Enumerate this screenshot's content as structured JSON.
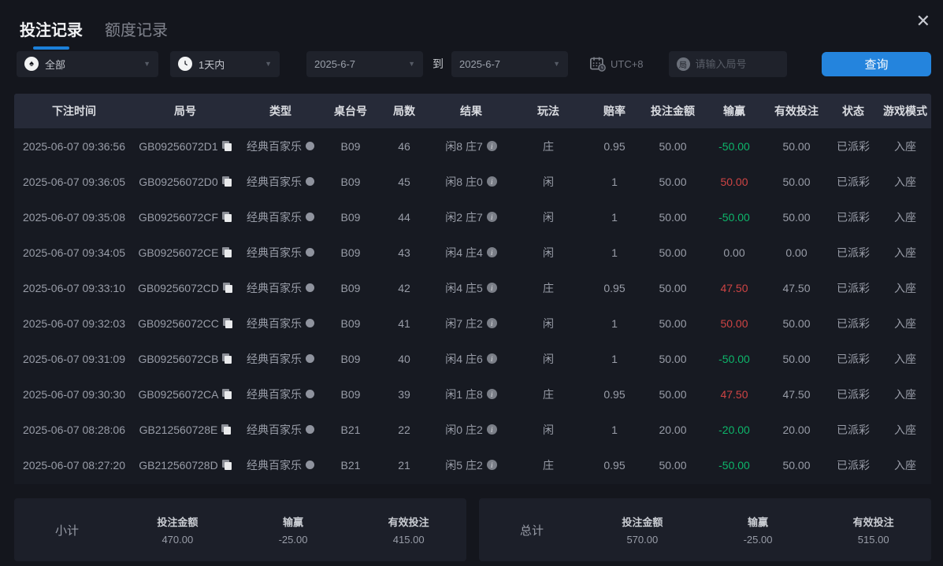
{
  "tabs": [
    {
      "label": "投注记录",
      "active": true
    },
    {
      "label": "额度记录",
      "active": false
    }
  ],
  "icons": {
    "spade": "♠",
    "chevron": "▼",
    "close": "✕",
    "round_badge": "局",
    "info": "i"
  },
  "filters": {
    "game_type_value": "全部",
    "time_range_value": "1天内",
    "date_from": "2025-6-7",
    "to_label": "到",
    "date_to": "2025-6-7",
    "timezone": "UTC+8",
    "round_placeholder": "请输入局号",
    "query_label": "查询"
  },
  "table": {
    "columns": [
      "下注时间",
      "局号",
      "类型",
      "桌台号",
      "局数",
      "结果",
      "玩法",
      "赔率",
      "投注金额",
      "输赢",
      "有效投注",
      "状态",
      "游戏模式"
    ],
    "rows": [
      {
        "time": "2025-06-07 09:36:56",
        "game_no": "GB09256072D1",
        "type": "经典百家乐",
        "table_no": "B09",
        "round": "46",
        "result": "闲8 庄7",
        "play": "庄",
        "odds": "0.95",
        "amount": "50.00",
        "win_loss": "-50.00",
        "win_loss_class": "neg",
        "valid": "50.00",
        "status": "已派彩",
        "mode": "入座"
      },
      {
        "time": "2025-06-07 09:36:05",
        "game_no": "GB09256072D0",
        "type": "经典百家乐",
        "table_no": "B09",
        "round": "45",
        "result": "闲8 庄0",
        "play": "闲",
        "odds": "1",
        "amount": "50.00",
        "win_loss": "50.00",
        "win_loss_class": "pos",
        "valid": "50.00",
        "status": "已派彩",
        "mode": "入座"
      },
      {
        "time": "2025-06-07 09:35:08",
        "game_no": "GB09256072CF",
        "type": "经典百家乐",
        "table_no": "B09",
        "round": "44",
        "result": "闲2 庄7",
        "play": "闲",
        "odds": "1",
        "amount": "50.00",
        "win_loss": "-50.00",
        "win_loss_class": "neg",
        "valid": "50.00",
        "status": "已派彩",
        "mode": "入座"
      },
      {
        "time": "2025-06-07 09:34:05",
        "game_no": "GB09256072CE",
        "type": "经典百家乐",
        "table_no": "B09",
        "round": "43",
        "result": "闲4 庄4",
        "play": "闲",
        "odds": "1",
        "amount": "50.00",
        "win_loss": "0.00",
        "win_loss_class": "zero",
        "valid": "0.00",
        "status": "已派彩",
        "mode": "入座"
      },
      {
        "time": "2025-06-07 09:33:10",
        "game_no": "GB09256072CD",
        "type": "经典百家乐",
        "table_no": "B09",
        "round": "42",
        "result": "闲4 庄5",
        "play": "庄",
        "odds": "0.95",
        "amount": "50.00",
        "win_loss": "47.50",
        "win_loss_class": "pos",
        "valid": "47.50",
        "status": "已派彩",
        "mode": "入座"
      },
      {
        "time": "2025-06-07 09:32:03",
        "game_no": "GB09256072CC",
        "type": "经典百家乐",
        "table_no": "B09",
        "round": "41",
        "result": "闲7 庄2",
        "play": "闲",
        "odds": "1",
        "amount": "50.00",
        "win_loss": "50.00",
        "win_loss_class": "pos",
        "valid": "50.00",
        "status": "已派彩",
        "mode": "入座"
      },
      {
        "time": "2025-06-07 09:31:09",
        "game_no": "GB09256072CB",
        "type": "经典百家乐",
        "table_no": "B09",
        "round": "40",
        "result": "闲4 庄6",
        "play": "闲",
        "odds": "1",
        "amount": "50.00",
        "win_loss": "-50.00",
        "win_loss_class": "neg",
        "valid": "50.00",
        "status": "已派彩",
        "mode": "入座"
      },
      {
        "time": "2025-06-07 09:30:30",
        "game_no": "GB09256072CA",
        "type": "经典百家乐",
        "table_no": "B09",
        "round": "39",
        "result": "闲1 庄8",
        "play": "庄",
        "odds": "0.95",
        "amount": "50.00",
        "win_loss": "47.50",
        "win_loss_class": "pos",
        "valid": "47.50",
        "status": "已派彩",
        "mode": "入座"
      },
      {
        "time": "2025-06-07 08:28:06",
        "game_no": "GB212560728E",
        "type": "经典百家乐",
        "table_no": "B21",
        "round": "22",
        "result": "闲0 庄2",
        "play": "闲",
        "odds": "1",
        "amount": "20.00",
        "win_loss": "-20.00",
        "win_loss_class": "neg",
        "valid": "20.00",
        "status": "已派彩",
        "mode": "入座"
      },
      {
        "time": "2025-06-07 08:27:20",
        "game_no": "GB212560728D",
        "type": "经典百家乐",
        "table_no": "B21",
        "round": "21",
        "result": "闲5 庄2",
        "play": "庄",
        "odds": "0.95",
        "amount": "50.00",
        "win_loss": "-50.00",
        "win_loss_class": "neg",
        "valid": "50.00",
        "status": "已派彩",
        "mode": "入座"
      }
    ]
  },
  "summary": {
    "subtotal": {
      "title": "小计",
      "stats": [
        {
          "label": "投注金额",
          "value": "470.00",
          "value_class": ""
        },
        {
          "label": "输赢",
          "value": "-25.00",
          "value_class": "neg"
        },
        {
          "label": "有效投注",
          "value": "415.00",
          "value_class": ""
        }
      ]
    },
    "total": {
      "title": "总计",
      "stats": [
        {
          "label": "投注金额",
          "value": "570.00",
          "value_class": ""
        },
        {
          "label": "输赢",
          "value": "-25.00",
          "value_class": "neg"
        },
        {
          "label": "有效投注",
          "value": "515.00",
          "value_class": ""
        }
      ]
    }
  },
  "colors": {
    "accent": "#2484dd",
    "tab_underline": "#1c80d9",
    "win_red": "#cf4444",
    "loss_green": "#0db56a",
    "header_bg": "#262a38",
    "body_bg": "#171a22",
    "page_bg": "#14161d"
  }
}
